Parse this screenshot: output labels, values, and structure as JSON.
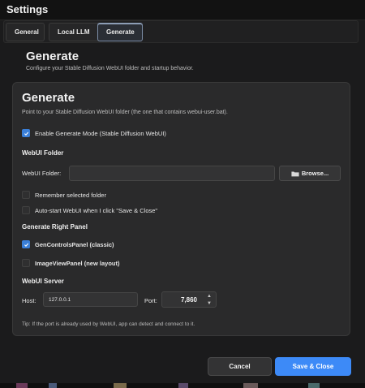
{
  "window": {
    "title": "Settings"
  },
  "tabs": [
    {
      "label": "General",
      "active": false
    },
    {
      "label": "Local LLM",
      "active": false
    },
    {
      "label": "Generate",
      "active": true
    }
  ],
  "header": {
    "title": "Generate",
    "description": "Configure your Stable Diffusion WebUI folder and startup behavior."
  },
  "card": {
    "title": "Generate",
    "subtitle": "Point to your Stable Diffusion WebUI folder (the one that contains webui-user.bat).",
    "enable_generate": {
      "label": "Enable Generate Mode (Stable Diffusion WebUI)",
      "checked": true
    },
    "webui_folder": {
      "section": "WebUI Folder",
      "field_label": "WebUI Folder:",
      "value": "",
      "browse_label": "Browse...",
      "remember": {
        "label": "Remember selected folder",
        "checked": false
      },
      "autostart": {
        "label": "Auto-start WebUI when I click \"Save & Close\"",
        "checked": false
      }
    },
    "right_panel": {
      "section": "Generate Right Panel",
      "options": [
        {
          "label": "GenControlsPanel (classic)",
          "checked": true
        },
        {
          "label": "ImageViewPanel (new layout)",
          "checked": false
        }
      ]
    },
    "server": {
      "section": "WebUI Server",
      "host_label": "Host:",
      "host_value": "127.0.0.1",
      "port_label": "Port:",
      "port_value": "7,860"
    },
    "tip": "Tip: If the port is already used by WebUI, app can detect and connect to it."
  },
  "footer": {
    "cancel_label": "Cancel",
    "save_label": "Save & Close"
  },
  "colors": {
    "accent": "#3d8af7",
    "background": "#1b1b1c",
    "card": "#2a2a2b"
  },
  "icons": {
    "browse": "folder-icon",
    "checkbox": "check-icon",
    "spin_up": "chevron-up-icon",
    "spin_down": "chevron-down-icon"
  }
}
